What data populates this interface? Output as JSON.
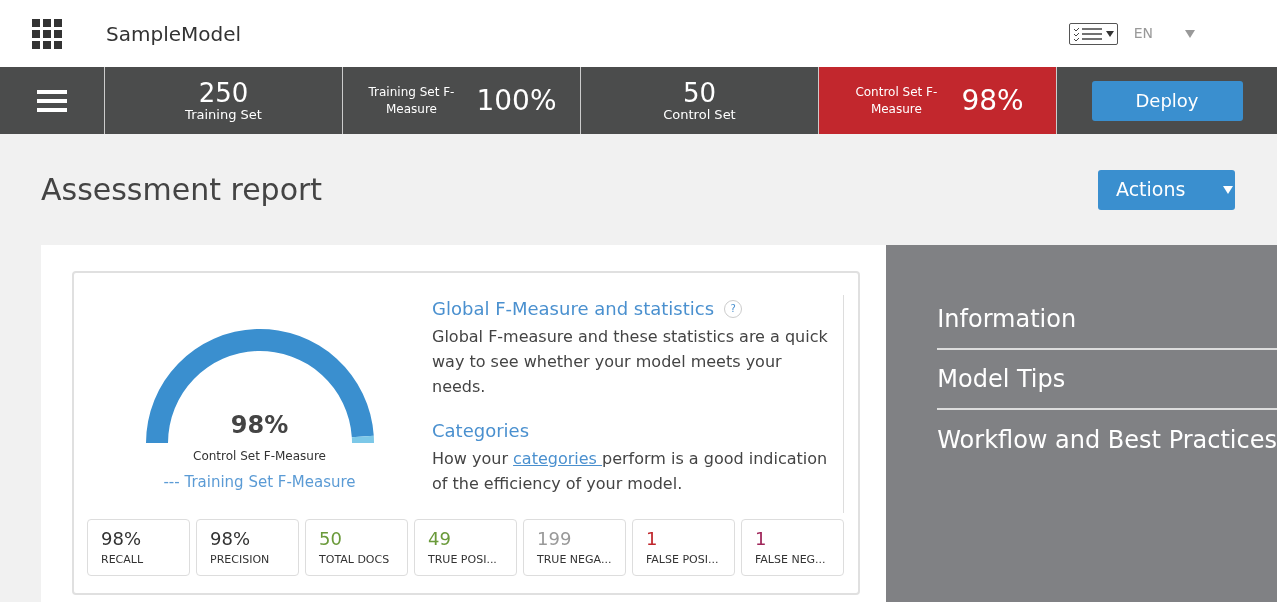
{
  "header": {
    "title": "SampleModel",
    "language": "EN"
  },
  "summary": [
    {
      "kind": "stacked",
      "value": "250",
      "label": "Training Set",
      "alert": false
    },
    {
      "kind": "inline",
      "value": "100%",
      "label": "Training Set F-Measure",
      "alert": false
    },
    {
      "kind": "stacked",
      "value": "50",
      "label": "Control Set",
      "alert": false
    },
    {
      "kind": "inline",
      "value": "98%",
      "label": "Control Set F-Measure",
      "alert": true
    }
  ],
  "deploy_button": "Deploy",
  "page_title": "Assessment report",
  "actions_button": "Actions",
  "gauge": {
    "level": 0.98,
    "value": "98%",
    "label": "Control Set F-Measure",
    "legend": "--- Training Set F-Measure"
  },
  "info": {
    "heading": "Global F-Measure and statistics",
    "help": "?",
    "text": "Global F-measure and these statistics are a quick way to see whether your model meets your needs.",
    "categories_heading": "Categories",
    "categories_before": "How your ",
    "categories_link": "categories ",
    "categories_after": "perform is a good indication of the efficiency of your model."
  },
  "stats": [
    {
      "value": "98%",
      "label": "RECALL",
      "color": "#333333"
    },
    {
      "value": "98%",
      "label": "PRECISION",
      "color": "#333333"
    },
    {
      "value": "50",
      "label": "TOTAL DOCS",
      "color": "#6a9a3a"
    },
    {
      "value": "49",
      "label": "TRUE POSI...",
      "color": "#6a9a3a"
    },
    {
      "value": "199",
      "label": "TRUE NEGA...",
      "color": "#999999"
    },
    {
      "value": "1",
      "label": "FALSE POSI...",
      "color": "#c0272d"
    },
    {
      "value": "1",
      "label": "FALSE NEG...",
      "color": "#a0265a"
    }
  ],
  "side_panel": {
    "items": [
      "Information",
      "Model Tips",
      "Workflow and Best Practices"
    ]
  }
}
